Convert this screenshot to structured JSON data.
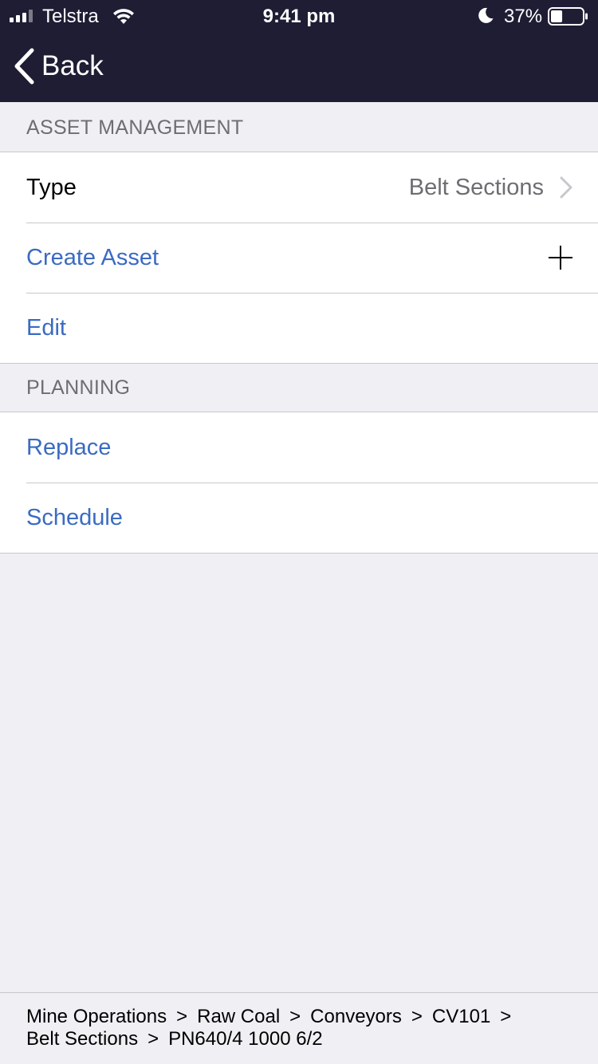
{
  "status_bar": {
    "carrier": "Telstra",
    "time": "9:41 pm",
    "battery_percent": "37%",
    "battery_level": 0.37,
    "icons": [
      "signal-icon",
      "wifi-icon",
      "moon-icon",
      "battery-icon"
    ]
  },
  "nav": {
    "back_label": "Back"
  },
  "asset_management": {
    "header": "ASSET MANAGEMENT",
    "type_label": "Type",
    "type_value": "Belt Sections",
    "create_label": "Create Asset",
    "edit_label": "Edit"
  },
  "planning": {
    "header": "PLANNING",
    "replace_label": "Replace",
    "schedule_label": "Schedule"
  },
  "breadcrumb": {
    "separator": ">",
    "line1": [
      "Mine Operations",
      "Raw Coal",
      "Conveyors",
      "CV101"
    ],
    "line2": [
      "Belt Sections",
      "PN640/4 1000 6/2"
    ]
  },
  "colors": {
    "nav_background": "#1e1d34",
    "link": "#3a6bc2",
    "page_background": "#efeff4",
    "separator": "#c8c7cc"
  }
}
